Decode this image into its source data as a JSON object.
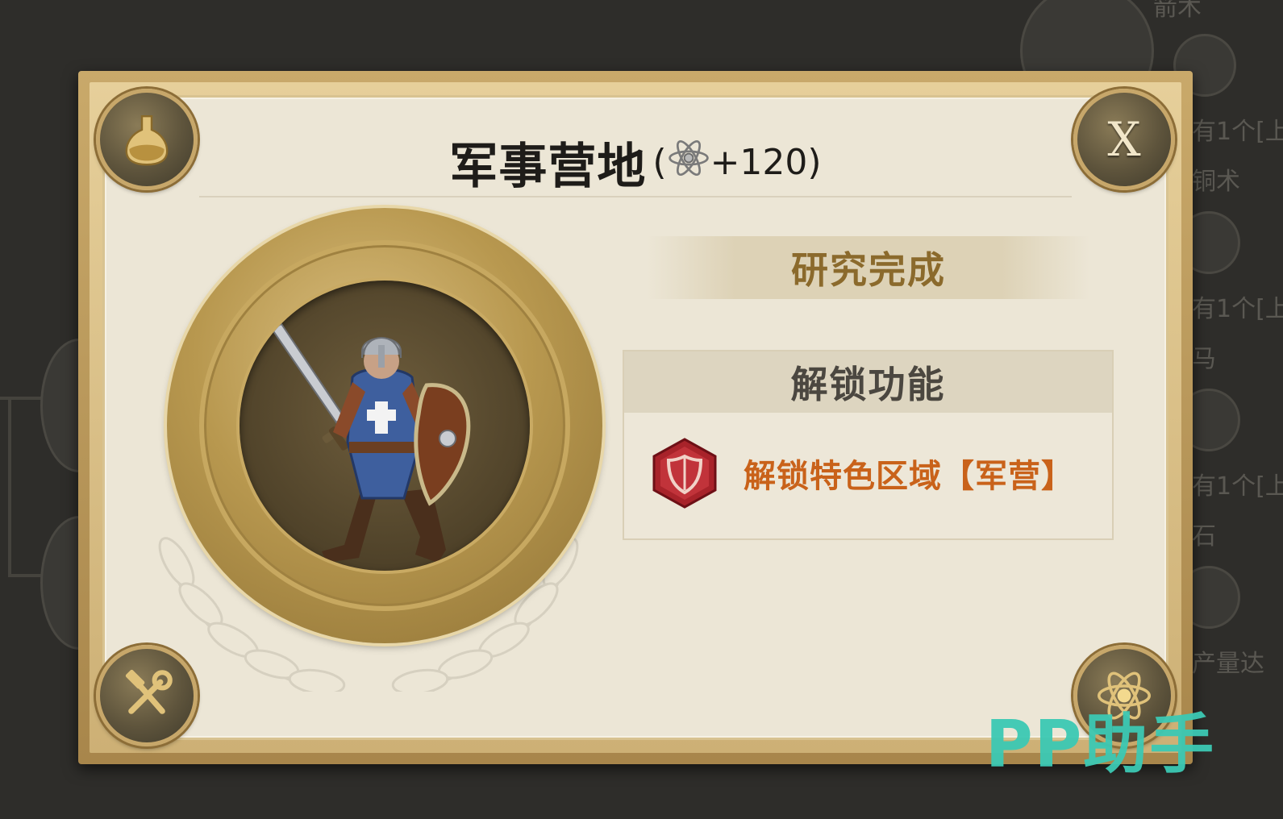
{
  "background": {
    "labels": [
      "箭术",
      "有1个[上",
      "铜术",
      "有1个[上",
      "马",
      "有1个[上",
      "石",
      "产量达"
    ]
  },
  "dialog": {
    "title": "军事营地",
    "bonus_open": "(",
    "bonus_value": "+120",
    "bonus_close": ")",
    "bonus_icon": "science-atom-icon",
    "close_label": "X",
    "status": "研究完成",
    "unlock_section_title": "解锁功能",
    "unlock_items": [
      {
        "icon": "red-shield-hexagon-icon",
        "label": "解锁特色区域【军营】"
      }
    ],
    "portrait": "armored-swordsman-with-shield",
    "corners": {
      "top_left": "flask-icon",
      "top_right": "close-icon",
      "bottom_left": "hammer-wrench-icon",
      "bottom_right": "atom-icon"
    }
  },
  "watermark": {
    "text": "PP助手",
    "color": "#3cc9b4"
  },
  "colors": {
    "title": "#1e1c19",
    "status": "#8b6a2c",
    "unlock_item": "#c9621a",
    "frame_gold": "#c9a96a",
    "panel": "#ece6d6"
  }
}
